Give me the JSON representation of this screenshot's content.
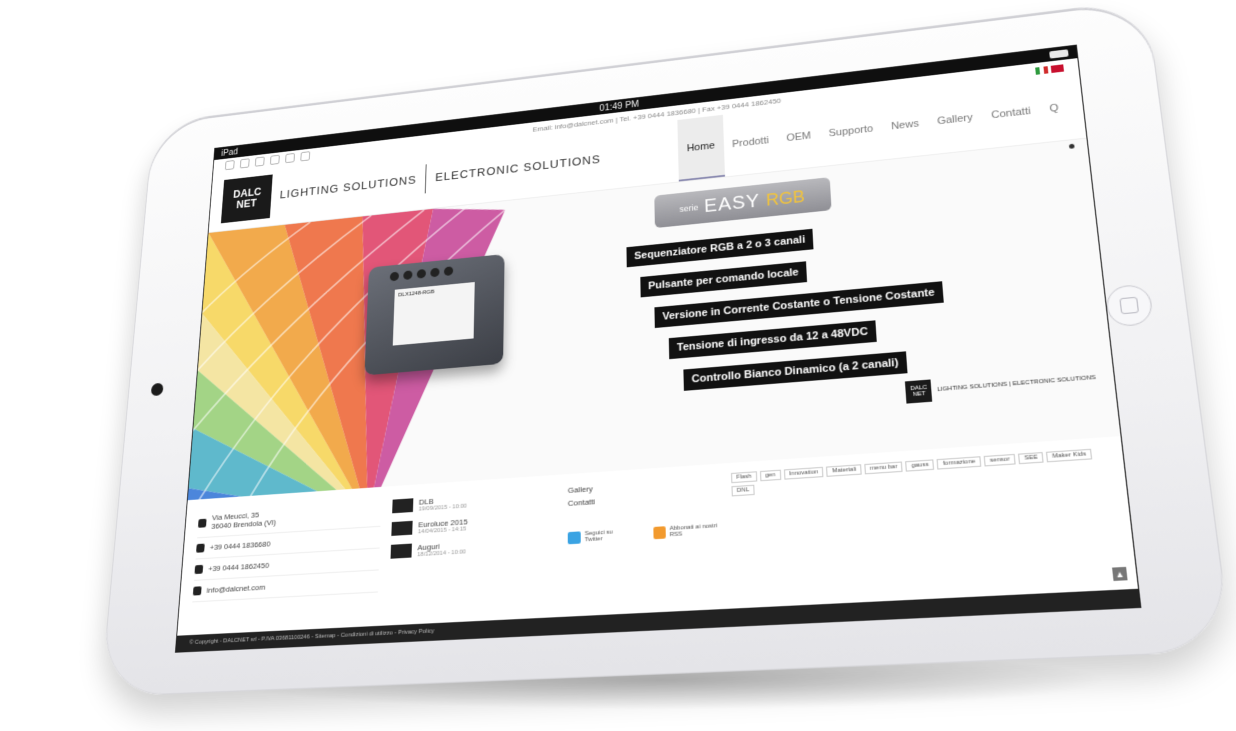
{
  "statusbar": {
    "left": "iPad",
    "time": "01:49 PM"
  },
  "topbar": {
    "contact": "Email: info@dalcnet.com | Tel. +39 0444 1836680 | Fax +39 0444 1862450"
  },
  "logo": {
    "box": "DALC NET",
    "line1": "LIGHTING SOLUTIONS",
    "line2": "ELECTRONIC SOLUTIONS"
  },
  "nav": [
    {
      "label": "Home",
      "active": true
    },
    {
      "label": "Prodotti"
    },
    {
      "label": "OEM"
    },
    {
      "label": "Supporto"
    },
    {
      "label": "News"
    },
    {
      "label": "Gallery"
    },
    {
      "label": "Contatti"
    },
    {
      "label": "Q"
    }
  ],
  "hero": {
    "series_prefix": "serie",
    "series_name": "EASY",
    "series_suffix": "RGB",
    "features": [
      "Sequenziatore RGB a 2 o 3 canali",
      "Pulsante per comando locale",
      "Versione in Corrente Costante o Tensione Costante",
      "Tensione di ingresso da 12 a 48VDC",
      "Controllo Bianco Dinamico (a 2 canali)"
    ],
    "module_label": "DLX1248-RGB",
    "mini_logo_box": "DALC NET",
    "mini_logo_text": "LIGHTING SOLUTIONS | ELECTRONIC SOLUTIONS"
  },
  "footer": {
    "address_line1": "Via Meucci, 35",
    "address_line2": "36040 Brendola (VI)",
    "phone": "+39 0444 1836680",
    "fax": "+39 0444 1862450",
    "email": "info@dalcnet.com",
    "news": [
      {
        "title": "DLB",
        "date": "19/09/2015 - 10:00"
      },
      {
        "title": "Euroluce 2015",
        "date": "14/04/2015 - 14:15"
      },
      {
        "title": "Auguri",
        "date": "18/12/2014 - 10:00"
      }
    ],
    "links": [
      "Gallery",
      "Contatti"
    ],
    "follow_twitter": "Seguici su Twitter",
    "follow_rss": "Abbonati ai nostri RSS",
    "tags": [
      "Flash",
      "gen",
      "Innovation",
      "Materiali",
      "menu bar",
      "gauss",
      "formazione",
      "sensor",
      "SEE",
      "Maker Kids",
      "DNL"
    ],
    "copyright": "© Copyright - DALCNET srl - P.IVA 03681100246 - Sitemap - Condizioni di utilizzo - Privacy Policy"
  },
  "colors": {
    "accent_nav": "#8a8ab0",
    "twitter": "#3aa3e3",
    "rss": "#f29a2e"
  }
}
